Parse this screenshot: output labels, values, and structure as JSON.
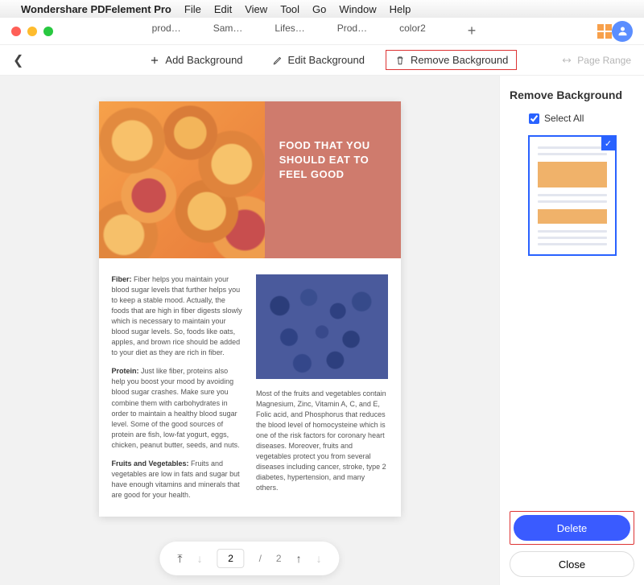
{
  "menubar": {
    "app": "Wondershare PDFelement Pro",
    "items": [
      "File",
      "Edit",
      "View",
      "Tool",
      "Go",
      "Window",
      "Help"
    ]
  },
  "tabs": [
    "prod…",
    "Sam…",
    "Lifes…",
    "Prod…",
    "color2"
  ],
  "toolbar": {
    "add_bg": "Add Background",
    "edit_bg": "Edit Background",
    "remove_bg": "Remove Background",
    "page_range": "Page Range"
  },
  "hero_title": "FOOD THAT YOU SHOULD EAT TO FEEL GOOD",
  "body": {
    "fiber_label": "Fiber:",
    "fiber": " Fiber helps you maintain your blood sugar levels that further helps you to keep a stable mood. Actually, the foods that are high in fiber digests slowly which is necessary to maintain your blood sugar levels. So, foods like oats, apples, and brown rice should be added to your diet as they are rich in fiber.",
    "protein_label": "Protein:",
    "protein": " Just like fiber, proteins also help you boost your mood by avoiding blood sugar crashes. Make sure you combine them with carbohydrates in order to maintain a healthy blood sugar level. Some of the good sources of protein are fish, low-fat yogurt, eggs, chicken, peanut butter, seeds, and nuts.",
    "fv_label": "Fruits and Vegetables:",
    "fv": " Fruits and vegetables are low in fats and sugar but have enough vitamins and minerals that are good for your health.",
    "right": "Most of the fruits and vegetables contain Magnesium, Zinc, Vitamin A, C, and E, Folic acid, and Phosphorus that reduces the blood level of homocysteine which is one of the risk factors for coronary heart diseases. Moreover, fruits and vegetables protect you from several diseases including cancer, stroke, type 2 diabetes, hypertension, and many others."
  },
  "pager": {
    "current": "2",
    "total": "2"
  },
  "sidepanel": {
    "title": "Remove Background",
    "select_all": "Select All",
    "delete": "Delete",
    "close": "Close"
  }
}
